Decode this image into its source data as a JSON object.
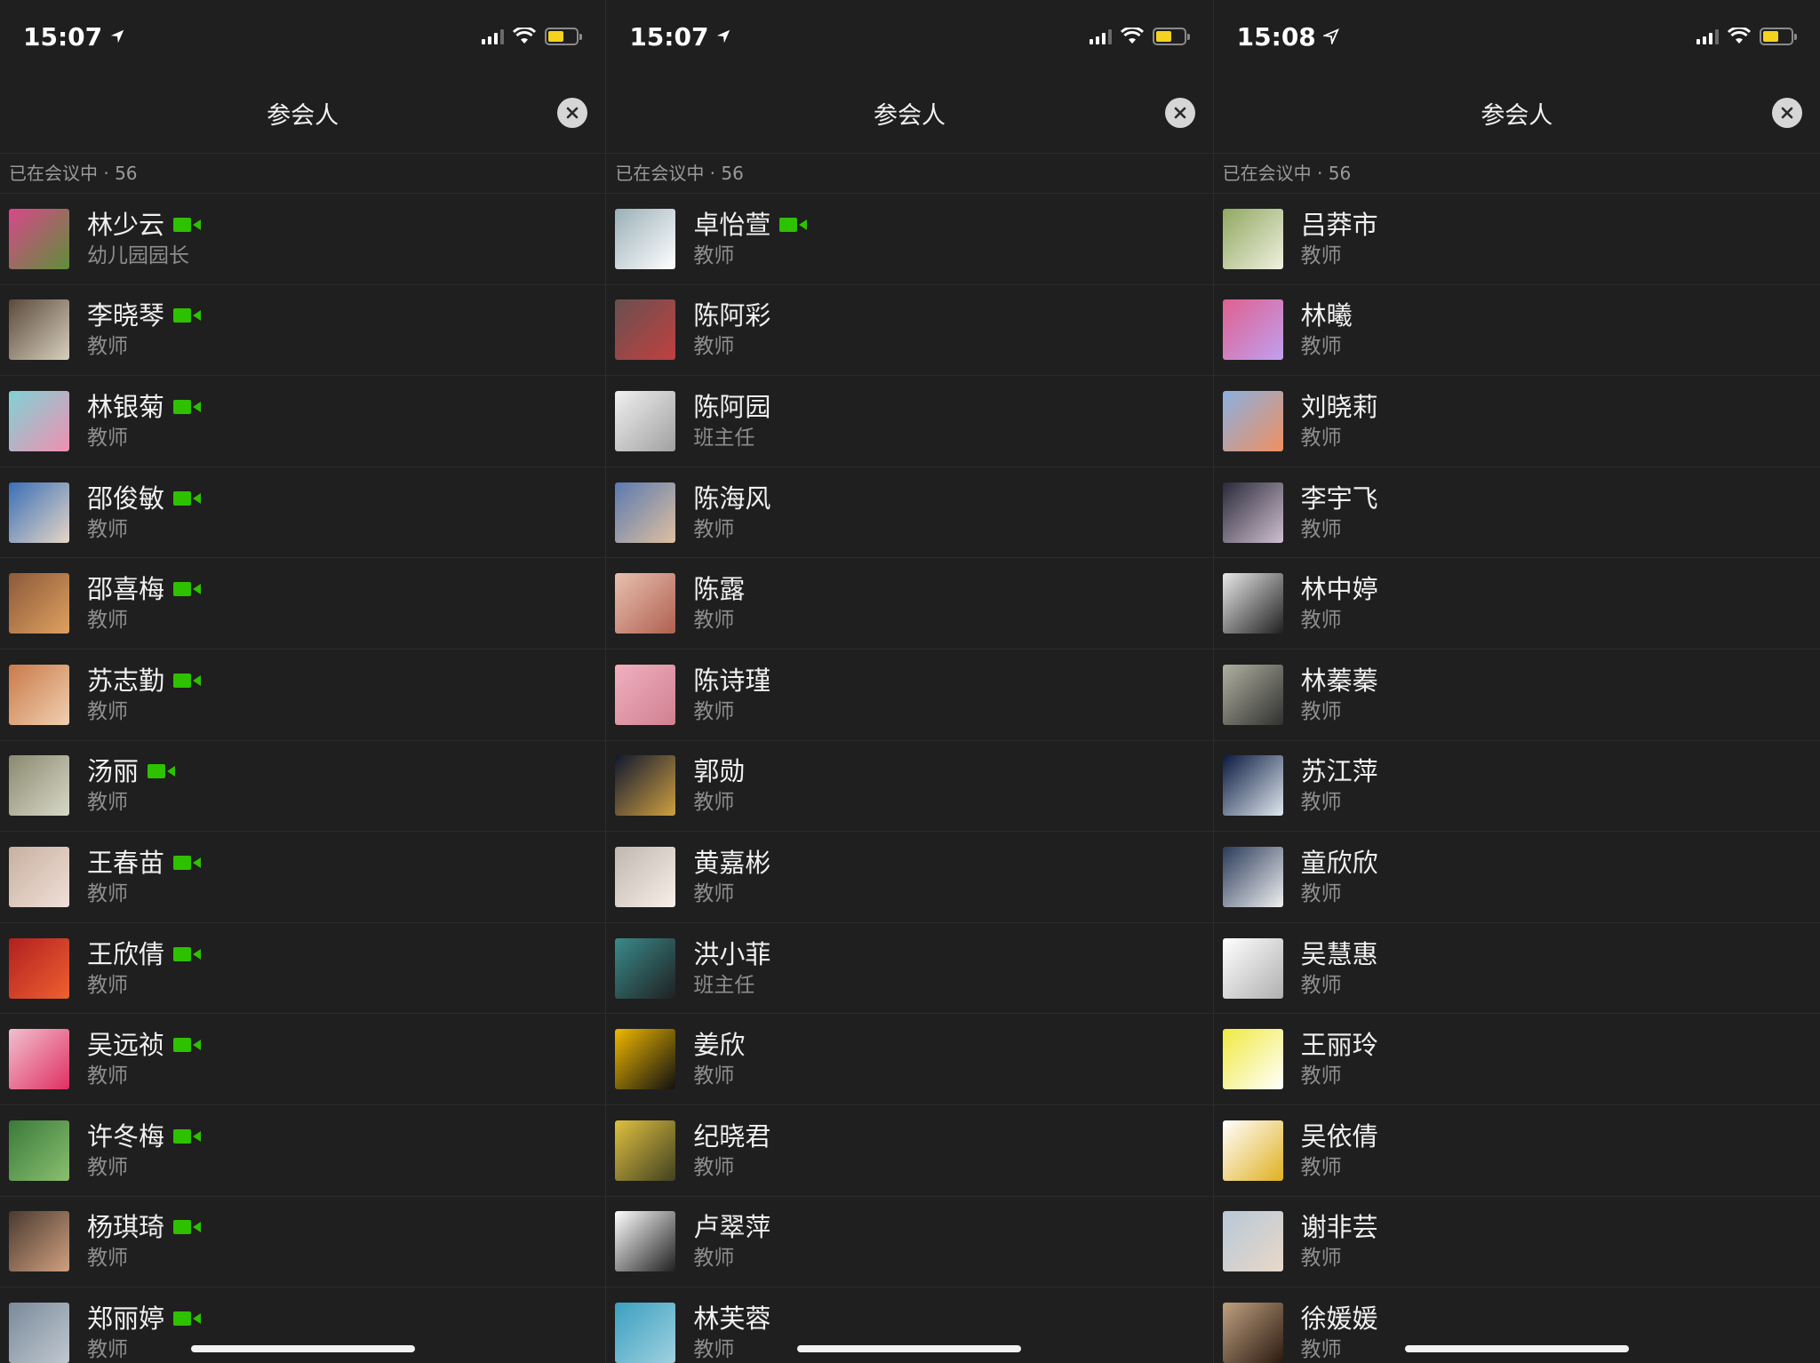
{
  "screens": [
    {
      "time": "15:07",
      "title": "参会人",
      "section": "已在会议中 · 56",
      "participants": [
        {
          "name": "林少云",
          "role": "幼儿园园长",
          "camera": true
        },
        {
          "name": "李晓琴",
          "role": "教师",
          "camera": true
        },
        {
          "name": "林银菊",
          "role": "教师",
          "camera": true
        },
        {
          "name": "邵俊敏",
          "role": "教师",
          "camera": true
        },
        {
          "name": "邵喜梅",
          "role": "教师",
          "camera": true
        },
        {
          "name": "苏志勤",
          "role": "教师",
          "camera": true
        },
        {
          "name": "汤丽",
          "role": "教师",
          "camera": true
        },
        {
          "name": "王春苗",
          "role": "教师",
          "camera": true
        },
        {
          "name": "王欣倩",
          "role": "教师",
          "camera": true
        },
        {
          "name": "吴远祯",
          "role": "教师",
          "camera": true
        },
        {
          "name": "许冬梅",
          "role": "教师",
          "camera": true
        },
        {
          "name": "杨琪琦",
          "role": "教师",
          "camera": true
        },
        {
          "name": "郑丽婷",
          "role": "教师",
          "camera": true
        }
      ]
    },
    {
      "time": "15:07",
      "title": "参会人",
      "section": "已在会议中 · 56",
      "participants": [
        {
          "name": "卓怡萱",
          "role": "教师",
          "camera": true
        },
        {
          "name": "陈阿彩",
          "role": "教师",
          "camera": false
        },
        {
          "name": "陈阿园",
          "role": "班主任",
          "camera": false
        },
        {
          "name": "陈海风",
          "role": "教师",
          "camera": false
        },
        {
          "name": "陈露",
          "role": "教师",
          "camera": false
        },
        {
          "name": "陈诗瑾",
          "role": "教师",
          "camera": false
        },
        {
          "name": "郭勋",
          "role": "教师",
          "camera": false
        },
        {
          "name": "黄嘉彬",
          "role": "教师",
          "camera": false
        },
        {
          "name": "洪小菲",
          "role": "班主任",
          "camera": false
        },
        {
          "name": "姜欣",
          "role": "教师",
          "camera": false
        },
        {
          "name": "纪晓君",
          "role": "教师",
          "camera": false
        },
        {
          "name": "卢翠萍",
          "role": "教师",
          "camera": false
        },
        {
          "name": "林芙蓉",
          "role": "教师",
          "camera": false
        }
      ]
    },
    {
      "time": "15:08",
      "title": "参会人",
      "section": "已在会议中 · 56",
      "participants": [
        {
          "name": "吕莽市",
          "role": "教师",
          "camera": false
        },
        {
          "name": "林曦",
          "role": "教师",
          "camera": false
        },
        {
          "name": "刘晓莉",
          "role": "教师",
          "camera": false
        },
        {
          "name": "李宇飞",
          "role": "教师",
          "camera": false
        },
        {
          "name": "林中婷",
          "role": "教师",
          "camera": false
        },
        {
          "name": "林蓁蓁",
          "role": "教师",
          "camera": false
        },
        {
          "name": "苏江萍",
          "role": "教师",
          "camera": false
        },
        {
          "name": "童欣欣",
          "role": "教师",
          "camera": false
        },
        {
          "name": "吴慧惠",
          "role": "教师",
          "camera": false
        },
        {
          "name": "王丽玲",
          "role": "教师",
          "camera": false
        },
        {
          "name": "吴依倩",
          "role": "教师",
          "camera": false
        },
        {
          "name": "谢非芸",
          "role": "教师",
          "camera": false
        },
        {
          "name": "徐媛媛",
          "role": "教师",
          "camera": false
        }
      ]
    }
  ],
  "colors": {
    "background": "#1f1f1f",
    "camera_green": "#2dc100",
    "battery_yellow": "#f4d21f"
  },
  "icons": {
    "camera": "video-camera-icon",
    "close": "close-icon",
    "location": "location-arrow-icon",
    "signal": "signal-icon",
    "wifi": "wifi-icon",
    "battery": "battery-icon"
  }
}
